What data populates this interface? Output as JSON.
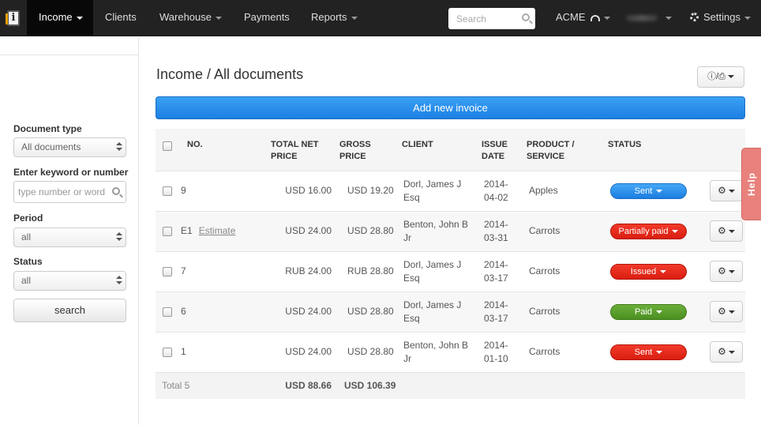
{
  "nav": {
    "items": [
      {
        "label": "Income"
      },
      {
        "label": "Clients"
      },
      {
        "label": "Warehouse"
      },
      {
        "label": "Payments"
      },
      {
        "label": "Reports"
      }
    ],
    "search_placeholder": "Search",
    "company": "ACME",
    "settings": "Settings"
  },
  "sidebar": {
    "doc_type_label": "Document type",
    "doc_type_value": "All documents",
    "keyword_label": "Enter keyword or number",
    "keyword_placeholder": "type number or word",
    "period_label": "Period",
    "period_value": "all",
    "status_label": "Status",
    "status_value": "all",
    "search_button": "search"
  },
  "main": {
    "title": "Income / All documents",
    "print_label": "/",
    "add_button": "Add new invoice"
  },
  "table": {
    "headers": {
      "no": "NO.",
      "net_1": "TOTAL NET",
      "net_2": "PRICE",
      "gross": "GROSS PRICE",
      "client": "CLIENT",
      "date_1": "ISSUE",
      "date_2": "DATE",
      "product_1": "PRODUCT /",
      "product_2": "SERVICE",
      "status": "STATUS"
    },
    "rows": [
      {
        "no": "9",
        "tag": "",
        "net": "USD 16.00",
        "gross": "USD 19.20",
        "client_1": "Dorl, James J",
        "client_2": "Esq",
        "date_1": "2014-",
        "date_2": "04-02",
        "product": "Apples",
        "status": "Sent",
        "status_color": "#1b7de0"
      },
      {
        "no": "E1",
        "tag": "Estimate",
        "net": "USD 24.00",
        "gross": "USD 28.80",
        "client_1": "Benton, John B",
        "client_2": "Jr",
        "date_1": "2014-",
        "date_2": "03-31",
        "product": "Carrots",
        "status": "Partially paid",
        "status_color": "#d91e10"
      },
      {
        "no": "7",
        "tag": "",
        "net": "RUB 24.00",
        "gross": "RUB 28.80",
        "client_1": "Dorl, James J",
        "client_2": "Esq",
        "date_1": "2014-",
        "date_2": "03-17",
        "product": "Carrots",
        "status": "Issued",
        "status_color": "#d91e10"
      },
      {
        "no": "6",
        "tag": "",
        "net": "USD 24.00",
        "gross": "USD 28.80",
        "client_1": "Dorl, James J",
        "client_2": "Esq",
        "date_1": "2014-",
        "date_2": "03-17",
        "product": "Carrots",
        "status": "Paid",
        "status_color": "#4b8f21"
      },
      {
        "no": "1",
        "tag": "",
        "net": "USD 24.00",
        "gross": "USD 28.80",
        "client_1": "Benton, John B",
        "client_2": "Jr",
        "date_1": "2014-",
        "date_2": "01-10",
        "product": "Carrots",
        "status": "Sent",
        "status_color": "#d91e10"
      }
    ],
    "total": {
      "label": "Total 5",
      "net": "USD 88.66",
      "gross": "USD 106.39"
    }
  },
  "help": "Help"
}
